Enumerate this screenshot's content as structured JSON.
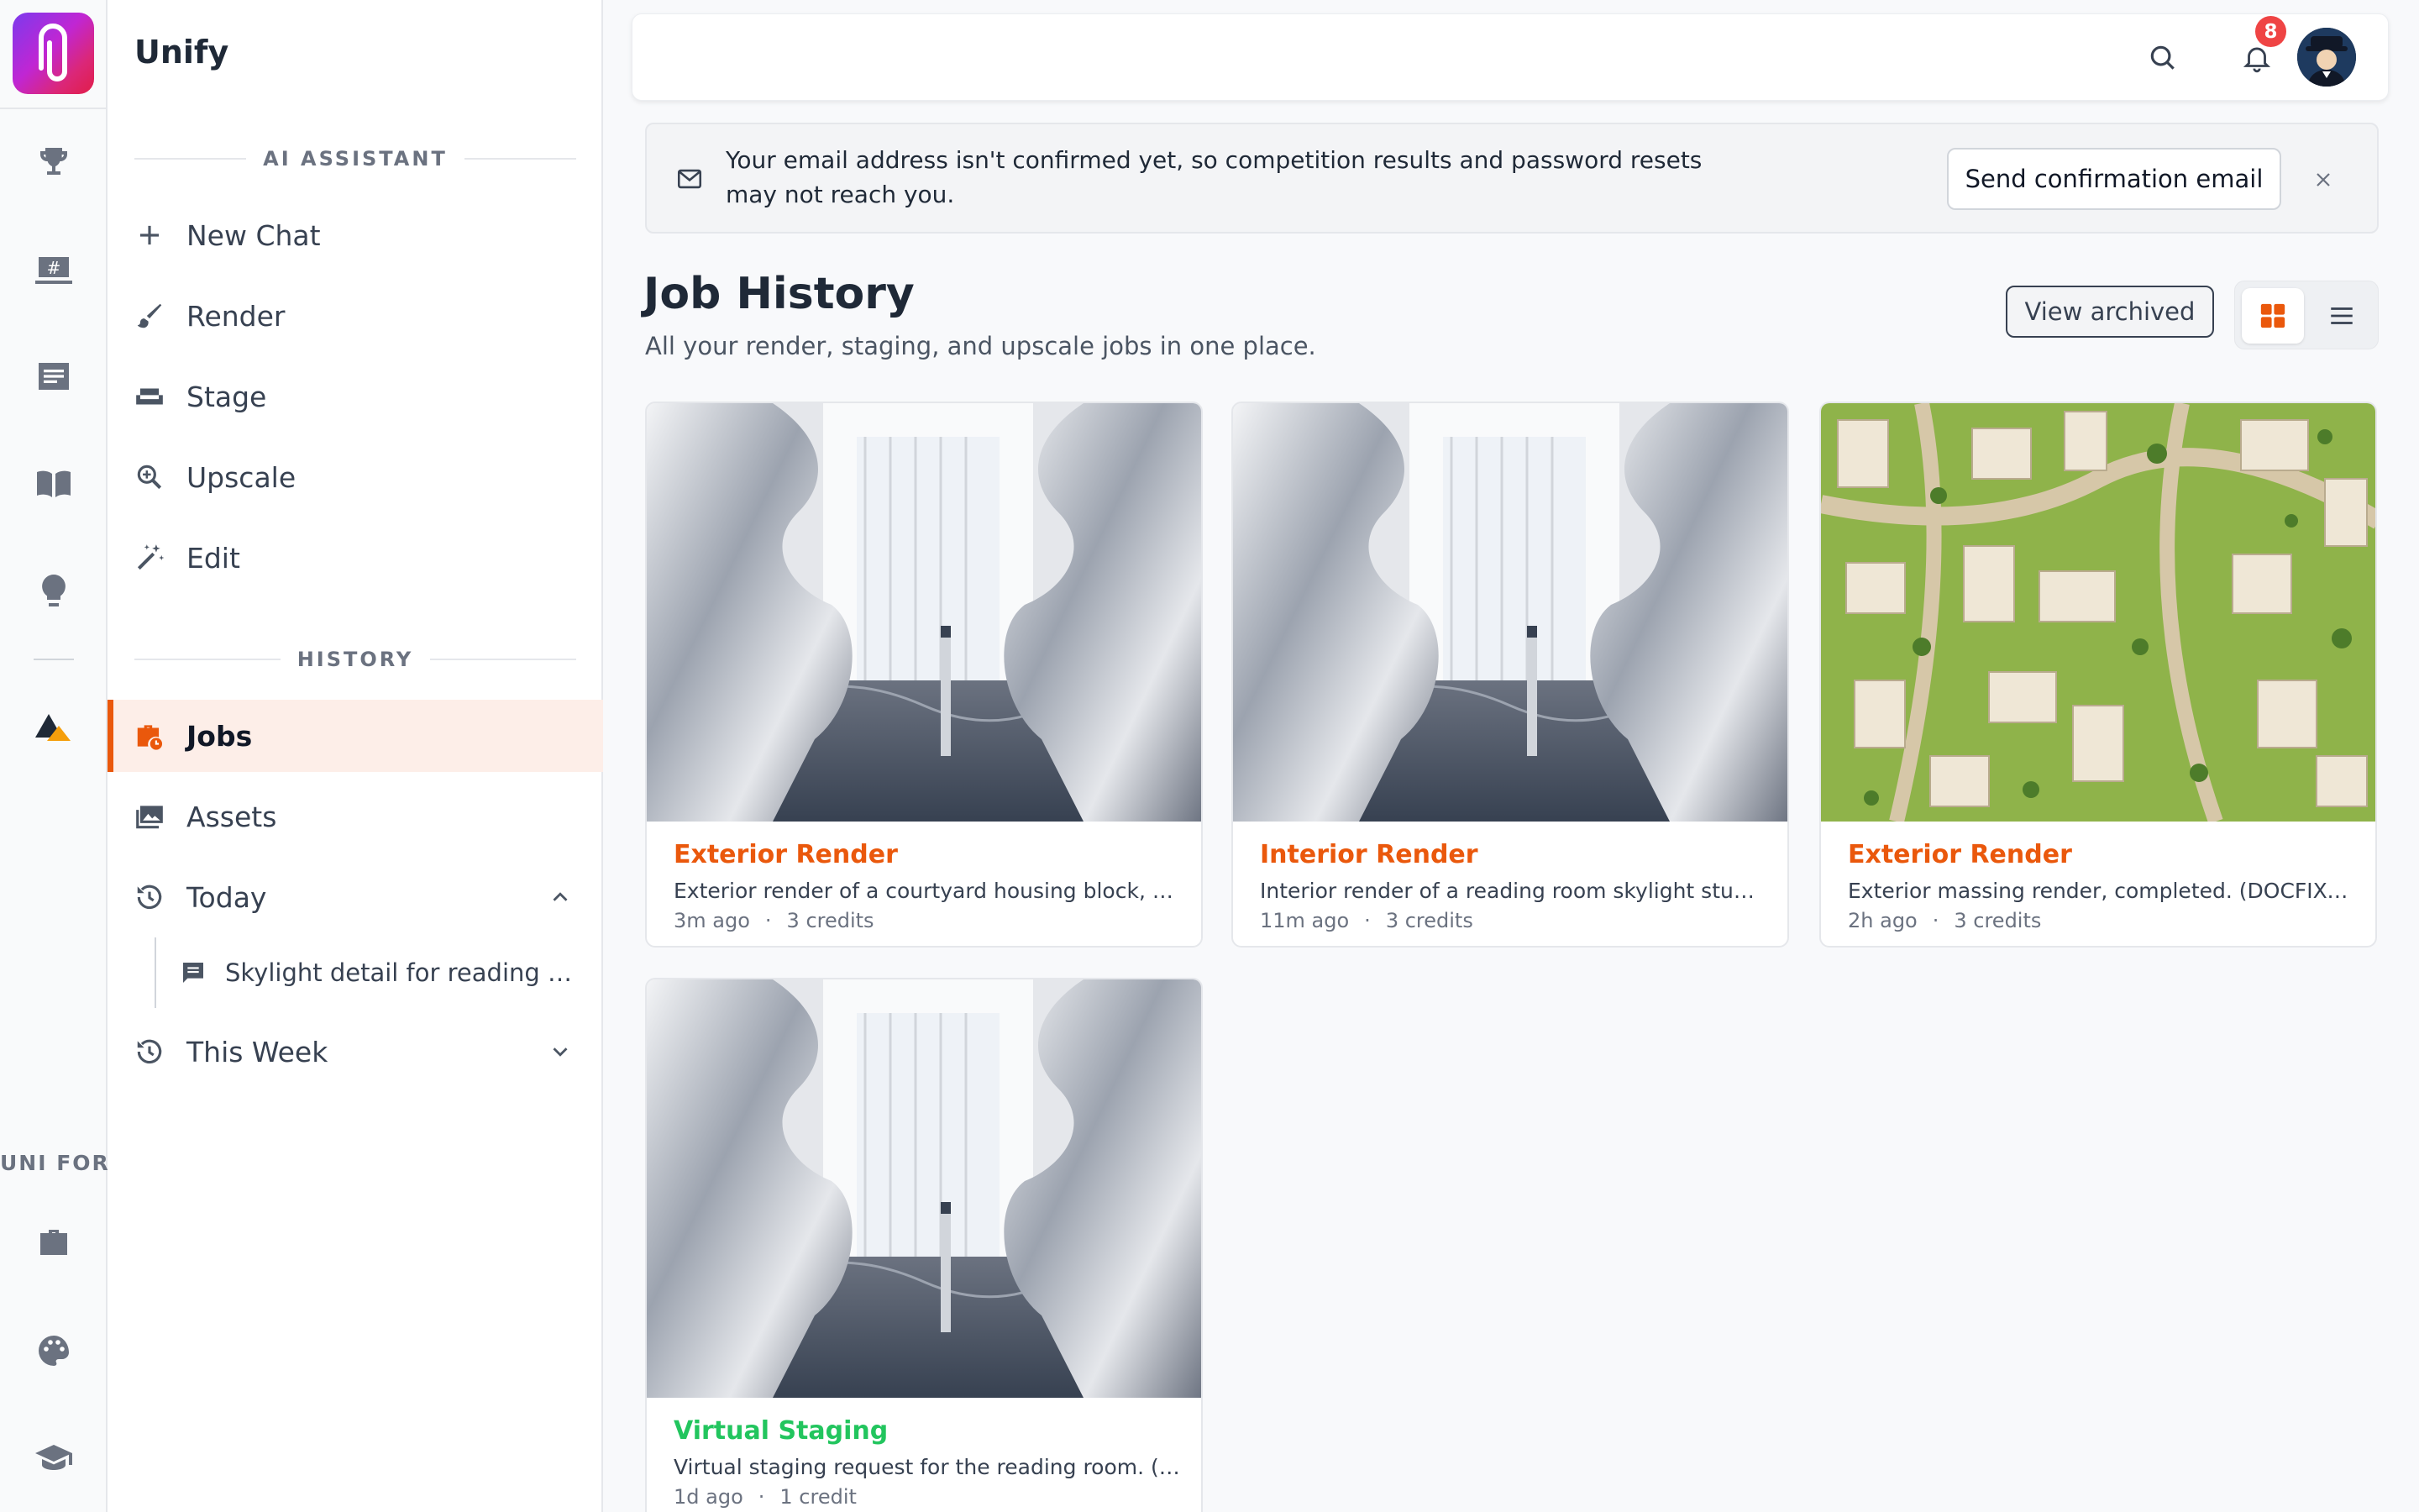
{
  "app": {
    "name": "Unify"
  },
  "colors": {
    "accent": "#ea580c",
    "staging": "#22c55e",
    "badge": "#ef4444"
  },
  "rail": {
    "items": [
      {
        "icon": "trophy-icon"
      },
      {
        "icon": "hashtag-screen-icon"
      },
      {
        "icon": "news-icon"
      },
      {
        "icon": "book-icon"
      },
      {
        "icon": "lightbulb-icon"
      },
      {
        "icon": "triangle-brand-icon"
      }
    ],
    "section_label": "UNI FOR",
    "bottom_items": [
      {
        "icon": "briefcase-icon"
      },
      {
        "icon": "palette-icon"
      },
      {
        "icon": "graduation-cap-icon"
      }
    ]
  },
  "sidebar": {
    "assistant_header": "AI ASSISTANT",
    "assistant_items": [
      {
        "label": "New Chat",
        "icon": "plus-icon"
      },
      {
        "label": "Render",
        "icon": "brush-icon"
      },
      {
        "label": "Stage",
        "icon": "sofa-icon"
      },
      {
        "label": "Upscale",
        "icon": "zoom-icon"
      },
      {
        "label": "Edit",
        "icon": "magic-wand-icon"
      }
    ],
    "history_header": "HISTORY",
    "history_items": [
      {
        "label": "Jobs",
        "icon": "briefcase-clock-icon",
        "active": true
      },
      {
        "label": "Assets",
        "icon": "images-icon"
      },
      {
        "label": "Today",
        "icon": "history-icon",
        "expanded": true
      },
      {
        "label": "This Week",
        "icon": "history-icon",
        "expanded": false
      }
    ],
    "today_items": [
      {
        "label": "Skylight detail for reading room"
      }
    ]
  },
  "topbar": {
    "notifications_count": "8"
  },
  "alert": {
    "message": "Your email address isn't confirmed yet, so competition results and password resets may not reach you.",
    "action_label": "Send confirmation email"
  },
  "page": {
    "title": "Job History",
    "subtitle": "All your render, staging, and upscale jobs in one place.",
    "view_archived_label": "View archived",
    "view_mode": "grid"
  },
  "jobs": [
    {
      "type": "Exterior Render",
      "type_color": "#ea580c",
      "description": "Exterior render of a courtyard housing block, delivered.",
      "time": "3m ago",
      "credits": "3 credits"
    },
    {
      "type": "Interior Render",
      "type_color": "#ea580c",
      "description": "Interior render of a reading room skylight study, completed.",
      "time": "11m ago",
      "credits": "3 credits"
    },
    {
      "type": "Exterior Render",
      "type_color": "#ea580c",
      "description": "Exterior massing render, completed. (DOCFIXTURE)",
      "time": "2h ago",
      "credits": "3 credits"
    },
    {
      "type": "Virtual Staging",
      "type_color": "#22c55e",
      "description": "Virtual staging request for the reading room. (DOCFIXTURE)",
      "time": "1d ago",
      "credits": "1 credit"
    }
  ]
}
